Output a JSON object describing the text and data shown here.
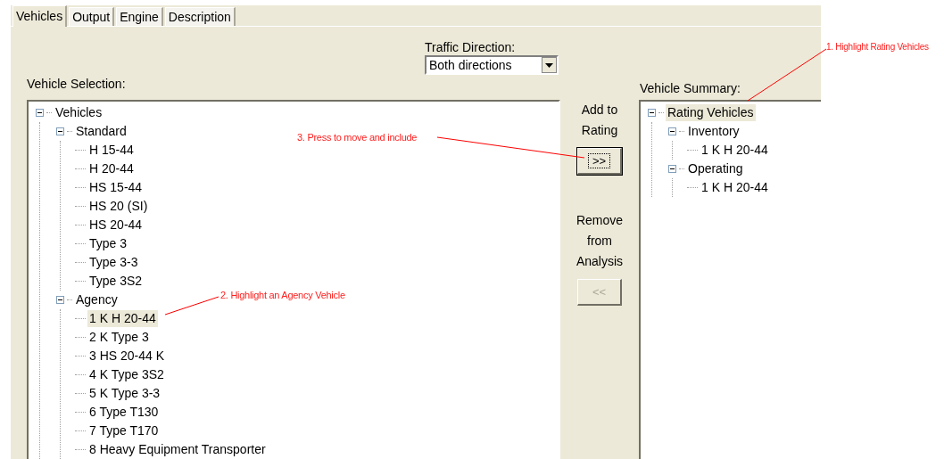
{
  "tabs": [
    {
      "label": "Vehicles",
      "selected": true
    },
    {
      "label": "Output",
      "selected": false
    },
    {
      "label": "Engine",
      "selected": false
    },
    {
      "label": "Description",
      "selected": false
    }
  ],
  "traffic_direction": {
    "label": "Traffic Direction:",
    "value": "Both directions"
  },
  "vehicle_selection": {
    "label": "Vehicle Selection:",
    "tree": [
      {
        "label": "Vehicles",
        "expanded": true,
        "selected": false,
        "children": [
          {
            "label": "Standard",
            "expanded": true,
            "selected": false,
            "children": [
              {
                "label": "H 15-44",
                "selected": false
              },
              {
                "label": "H 20-44",
                "selected": false
              },
              {
                "label": "HS 15-44",
                "selected": false
              },
              {
                "label": "HS 20 (SI)",
                "selected": false
              },
              {
                "label": "HS 20-44",
                "selected": false
              },
              {
                "label": "Type 3",
                "selected": false
              },
              {
                "label": "Type 3-3",
                "selected": false
              },
              {
                "label": "Type 3S2",
                "selected": false
              }
            ]
          },
          {
            "label": "Agency",
            "expanded": true,
            "selected": false,
            "children": [
              {
                "label": "1 K H 20-44",
                "selected": true
              },
              {
                "label": "2 K Type 3",
                "selected": false
              },
              {
                "label": "3 HS 20-44 K",
                "selected": false
              },
              {
                "label": "4 K Type 3S2",
                "selected": false
              },
              {
                "label": "5 K Type 3-3",
                "selected": false
              },
              {
                "label": "6 Type T130",
                "selected": false
              },
              {
                "label": "7 Type T170",
                "selected": false
              },
              {
                "label": "8 Heavy Equipment Transporter",
                "selected": false
              }
            ]
          }
        ]
      }
    ]
  },
  "add": {
    "caption": "Add to Rating",
    "button": ">>",
    "disabled": false
  },
  "remove": {
    "caption": "Remove from Analysis",
    "button": "<<",
    "disabled": true
  },
  "vehicle_summary": {
    "label": "Vehicle Summary:",
    "tree": [
      {
        "label": "Rating Vehicles",
        "expanded": true,
        "selected": true,
        "children": [
          {
            "label": "Inventory",
            "expanded": true,
            "selected": false,
            "children": [
              {
                "label": "1 K H 20-44",
                "selected": false
              }
            ]
          },
          {
            "label": "Operating",
            "expanded": true,
            "selected": false,
            "children": [
              {
                "label": "1 K H 20-44",
                "selected": false
              }
            ]
          }
        ]
      }
    ]
  },
  "annotations": [
    "1. Highlight Rating Vehicles",
    "2. Highlight an Agency Vehicle",
    "3. Press to move and include"
  ]
}
